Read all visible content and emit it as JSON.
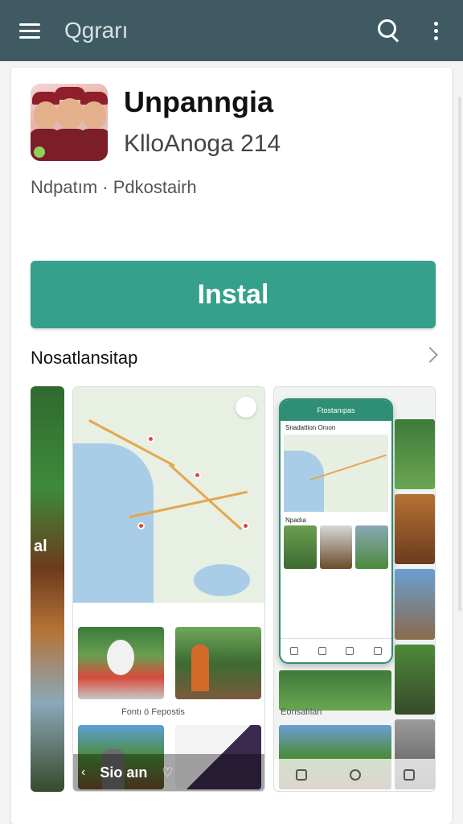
{
  "topbar": {
    "title": "Qgrarı",
    "menu_icon": "hamburger-menu-icon",
    "search_icon": "search-icon",
    "more_icon": "more-vertical-icon",
    "color": "#3f5a63"
  },
  "app": {
    "name": "Unpanngia",
    "developer": "KlloAnoga 214",
    "meta": "Ndpatım · Pdkostairh",
    "icon": "app-icon"
  },
  "install": {
    "label": "Instal",
    "color": "#35a18b"
  },
  "screenshots_section": {
    "title": "Nosatlansitap",
    "chevron_icon": "chevron-right-icon",
    "shot1_label": "al",
    "shot2_caption": "Fontı ö Fepostis",
    "shot2_bottom_label": "Sio aın",
    "shot3_phone_title": "Ftostanıpas",
    "shot3_phone_subtitle": "Snadattion Onıon",
    "shot3_phone_section": "Npadıa",
    "shot3_caption": "Eonsalılan"
  }
}
